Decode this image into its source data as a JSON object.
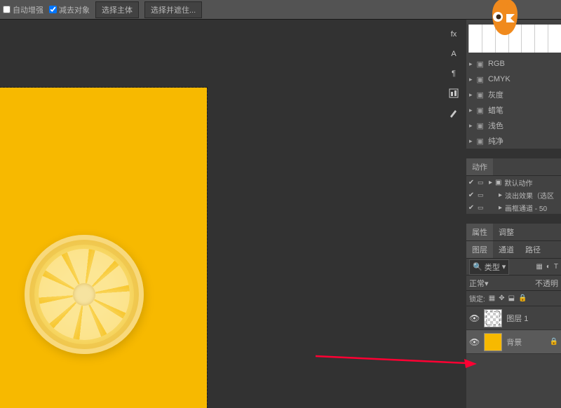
{
  "toolbar": {
    "autoEnhance": "自动增强",
    "subtractObject": "减去对象",
    "selectSubject": "选择主体",
    "selectAndMask": "选择并遮住..."
  },
  "channels": {
    "items": [
      "RGB",
      "CMYK",
      "灰度",
      "蜡笔",
      "浅色",
      "纯净"
    ]
  },
  "actionsPanel": {
    "tabLabel": "动作",
    "items": [
      {
        "label": "默认动作",
        "hasFolder": true
      },
      {
        "label": "淡出效果（选区",
        "hasFolder": false
      },
      {
        "label": "画框通道 - 50",
        "hasFolder": false
      }
    ]
  },
  "propertiesPanel": {
    "tabs": [
      "属性",
      "调整"
    ]
  },
  "layersPanel": {
    "tabs": [
      "图层",
      "通道",
      "路径"
    ],
    "typeFilter": "类型",
    "blendMode": "正常",
    "opacityLabel": "不透明",
    "lockLabel": "锁定:",
    "layers": [
      {
        "name": "图层 1",
        "selected": false,
        "bg": false
      },
      {
        "name": "背景",
        "selected": true,
        "bg": true
      }
    ]
  }
}
